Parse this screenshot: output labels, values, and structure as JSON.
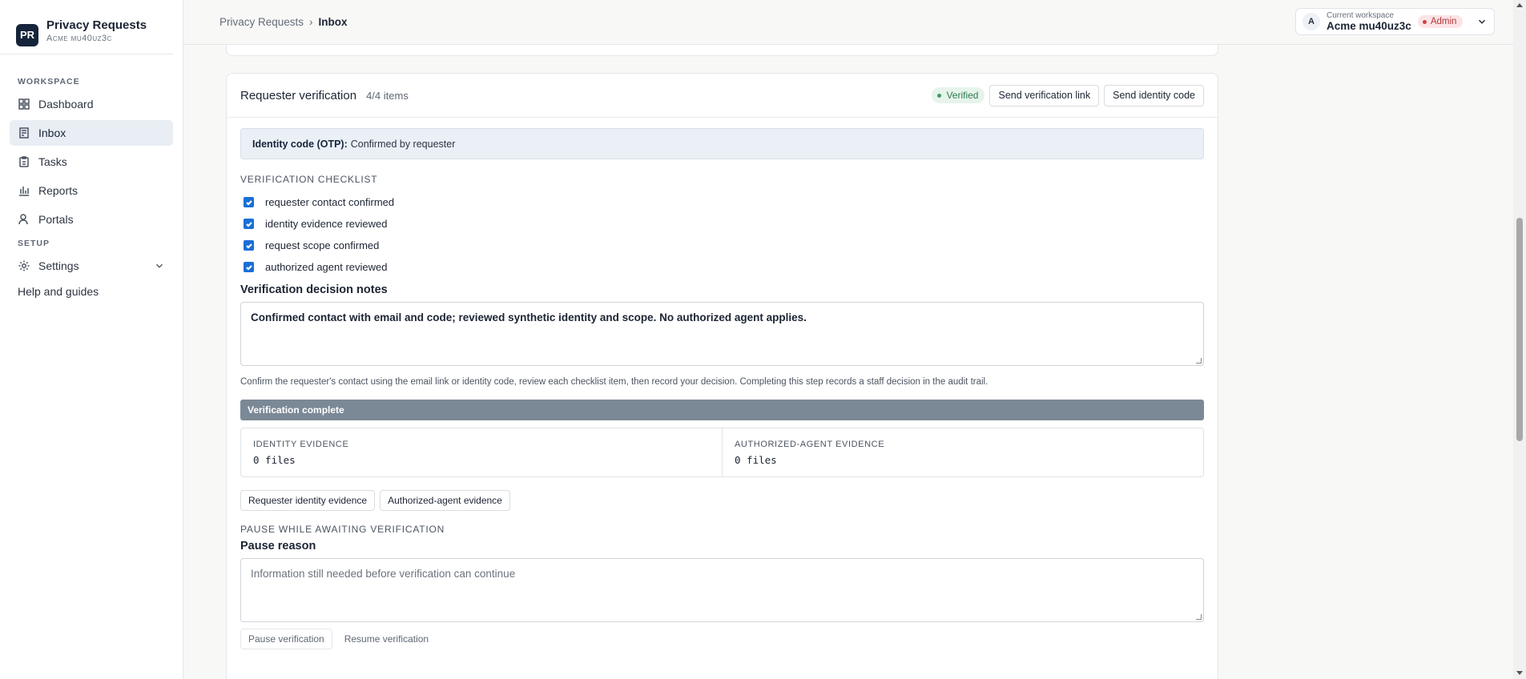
{
  "brand": {
    "logo": "PR",
    "title": "Privacy Requests",
    "org": "Acme mu40uz3c"
  },
  "sidebar": {
    "workspace_label": "WORKSPACE",
    "items": [
      {
        "label": "Dashboard",
        "icon": "grid-icon"
      },
      {
        "label": "Inbox",
        "icon": "inbox-icon",
        "active": true
      },
      {
        "label": "Tasks",
        "icon": "clipboard-icon"
      },
      {
        "label": "Reports",
        "icon": "chart-icon"
      },
      {
        "label": "Portals",
        "icon": "user-icon"
      }
    ],
    "setup_label": "SETUP",
    "settings_label": "Settings",
    "help_label": "Help and guides"
  },
  "breadcrumb": {
    "parent": "Privacy Requests",
    "sep": "›",
    "current": "Inbox"
  },
  "workspace": {
    "avatar": "A",
    "label": "Current workspace",
    "name": "Acme mu40uz3c",
    "role": "Admin"
  },
  "verification": {
    "title": "Requester verification",
    "count": "4/4 items",
    "status": "Verified",
    "send_link": "Send verification link",
    "send_code": "Send identity code",
    "otp_label": "Identity code (OTP):",
    "otp_value": "Confirmed by requester",
    "checklist_label": "VERIFICATION CHECKLIST",
    "checklist": [
      {
        "label": "requester contact confirmed",
        "checked": true
      },
      {
        "label": "identity evidence reviewed",
        "checked": true
      },
      {
        "label": "request scope confirmed",
        "checked": true
      },
      {
        "label": "authorized agent reviewed",
        "checked": true
      }
    ],
    "notes_label": "Verification decision notes",
    "notes_value": "Confirmed contact with email and code; reviewed synthetic identity and scope. No authorized agent applies.",
    "help_text": "Confirm the requester's contact using the email link or identity code, review each checklist item, then record your decision. Completing this step records a staff decision in the audit trail.",
    "progress_label": "Verification complete",
    "identity_evidence_label": "IDENTITY EVIDENCE",
    "identity_evidence_value": "0 files",
    "agent_evidence_label": "AUTHORIZED-AGENT EVIDENCE",
    "agent_evidence_value": "0 files",
    "identity_btn": "Requester identity evidence",
    "agent_btn": "Authorized-agent evidence",
    "pause_section": "PAUSE WHILE AWAITING VERIFICATION",
    "pause_reason_label": "Pause reason",
    "pause_placeholder": "Information still needed before verification can continue",
    "pause_btn": "Pause verification",
    "resume_btn": "Resume verification"
  }
}
